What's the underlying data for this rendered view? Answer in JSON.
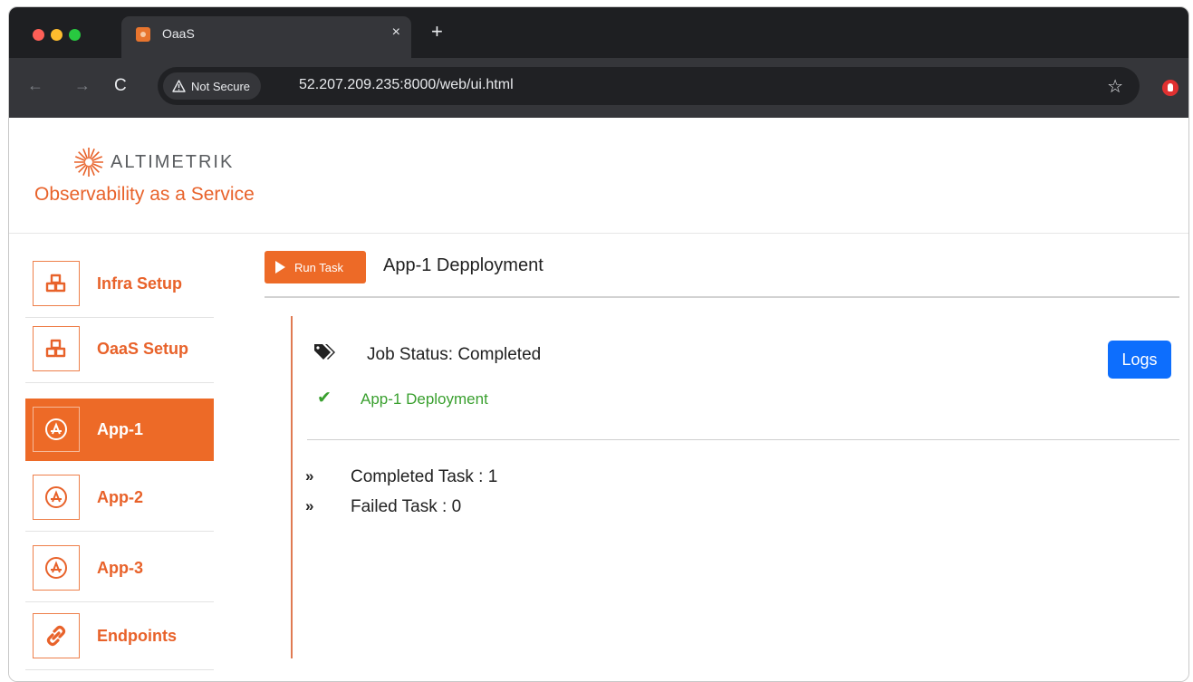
{
  "browser": {
    "tab_title": "OaaS",
    "tab_close": "×",
    "new_tab": "+",
    "security_label": "Not Secure",
    "url": "52.207.209.235:8000/web/ui.html"
  },
  "header": {
    "brand_name": "ALTIMETRIK",
    "tagline": "Observability as a Service"
  },
  "sidebar": {
    "items": [
      {
        "label": "Infra Setup",
        "icon": "cubes-icon",
        "active": false
      },
      {
        "label": "OaaS Setup",
        "icon": "cubes-icon",
        "active": false
      },
      {
        "label": "App-1",
        "icon": "app-store-icon",
        "active": true
      },
      {
        "label": "App-2",
        "icon": "app-store-icon",
        "active": false
      },
      {
        "label": "App-3",
        "icon": "app-store-icon",
        "active": false
      },
      {
        "label": "Endpoints",
        "icon": "link-icon",
        "active": false
      }
    ]
  },
  "main": {
    "run_task_label": "Run Task",
    "title": "App-1 Depployment",
    "job_status": "Job Status: Completed",
    "logs_label": "Logs",
    "completed_task_name": "App-1 Deployment",
    "completed_count": "Completed Task : 1",
    "failed_count": "Failed Task : 0"
  },
  "colors": {
    "accent": "#ed6a27",
    "success": "#3aa02f",
    "primary_button": "#0d6efd"
  }
}
